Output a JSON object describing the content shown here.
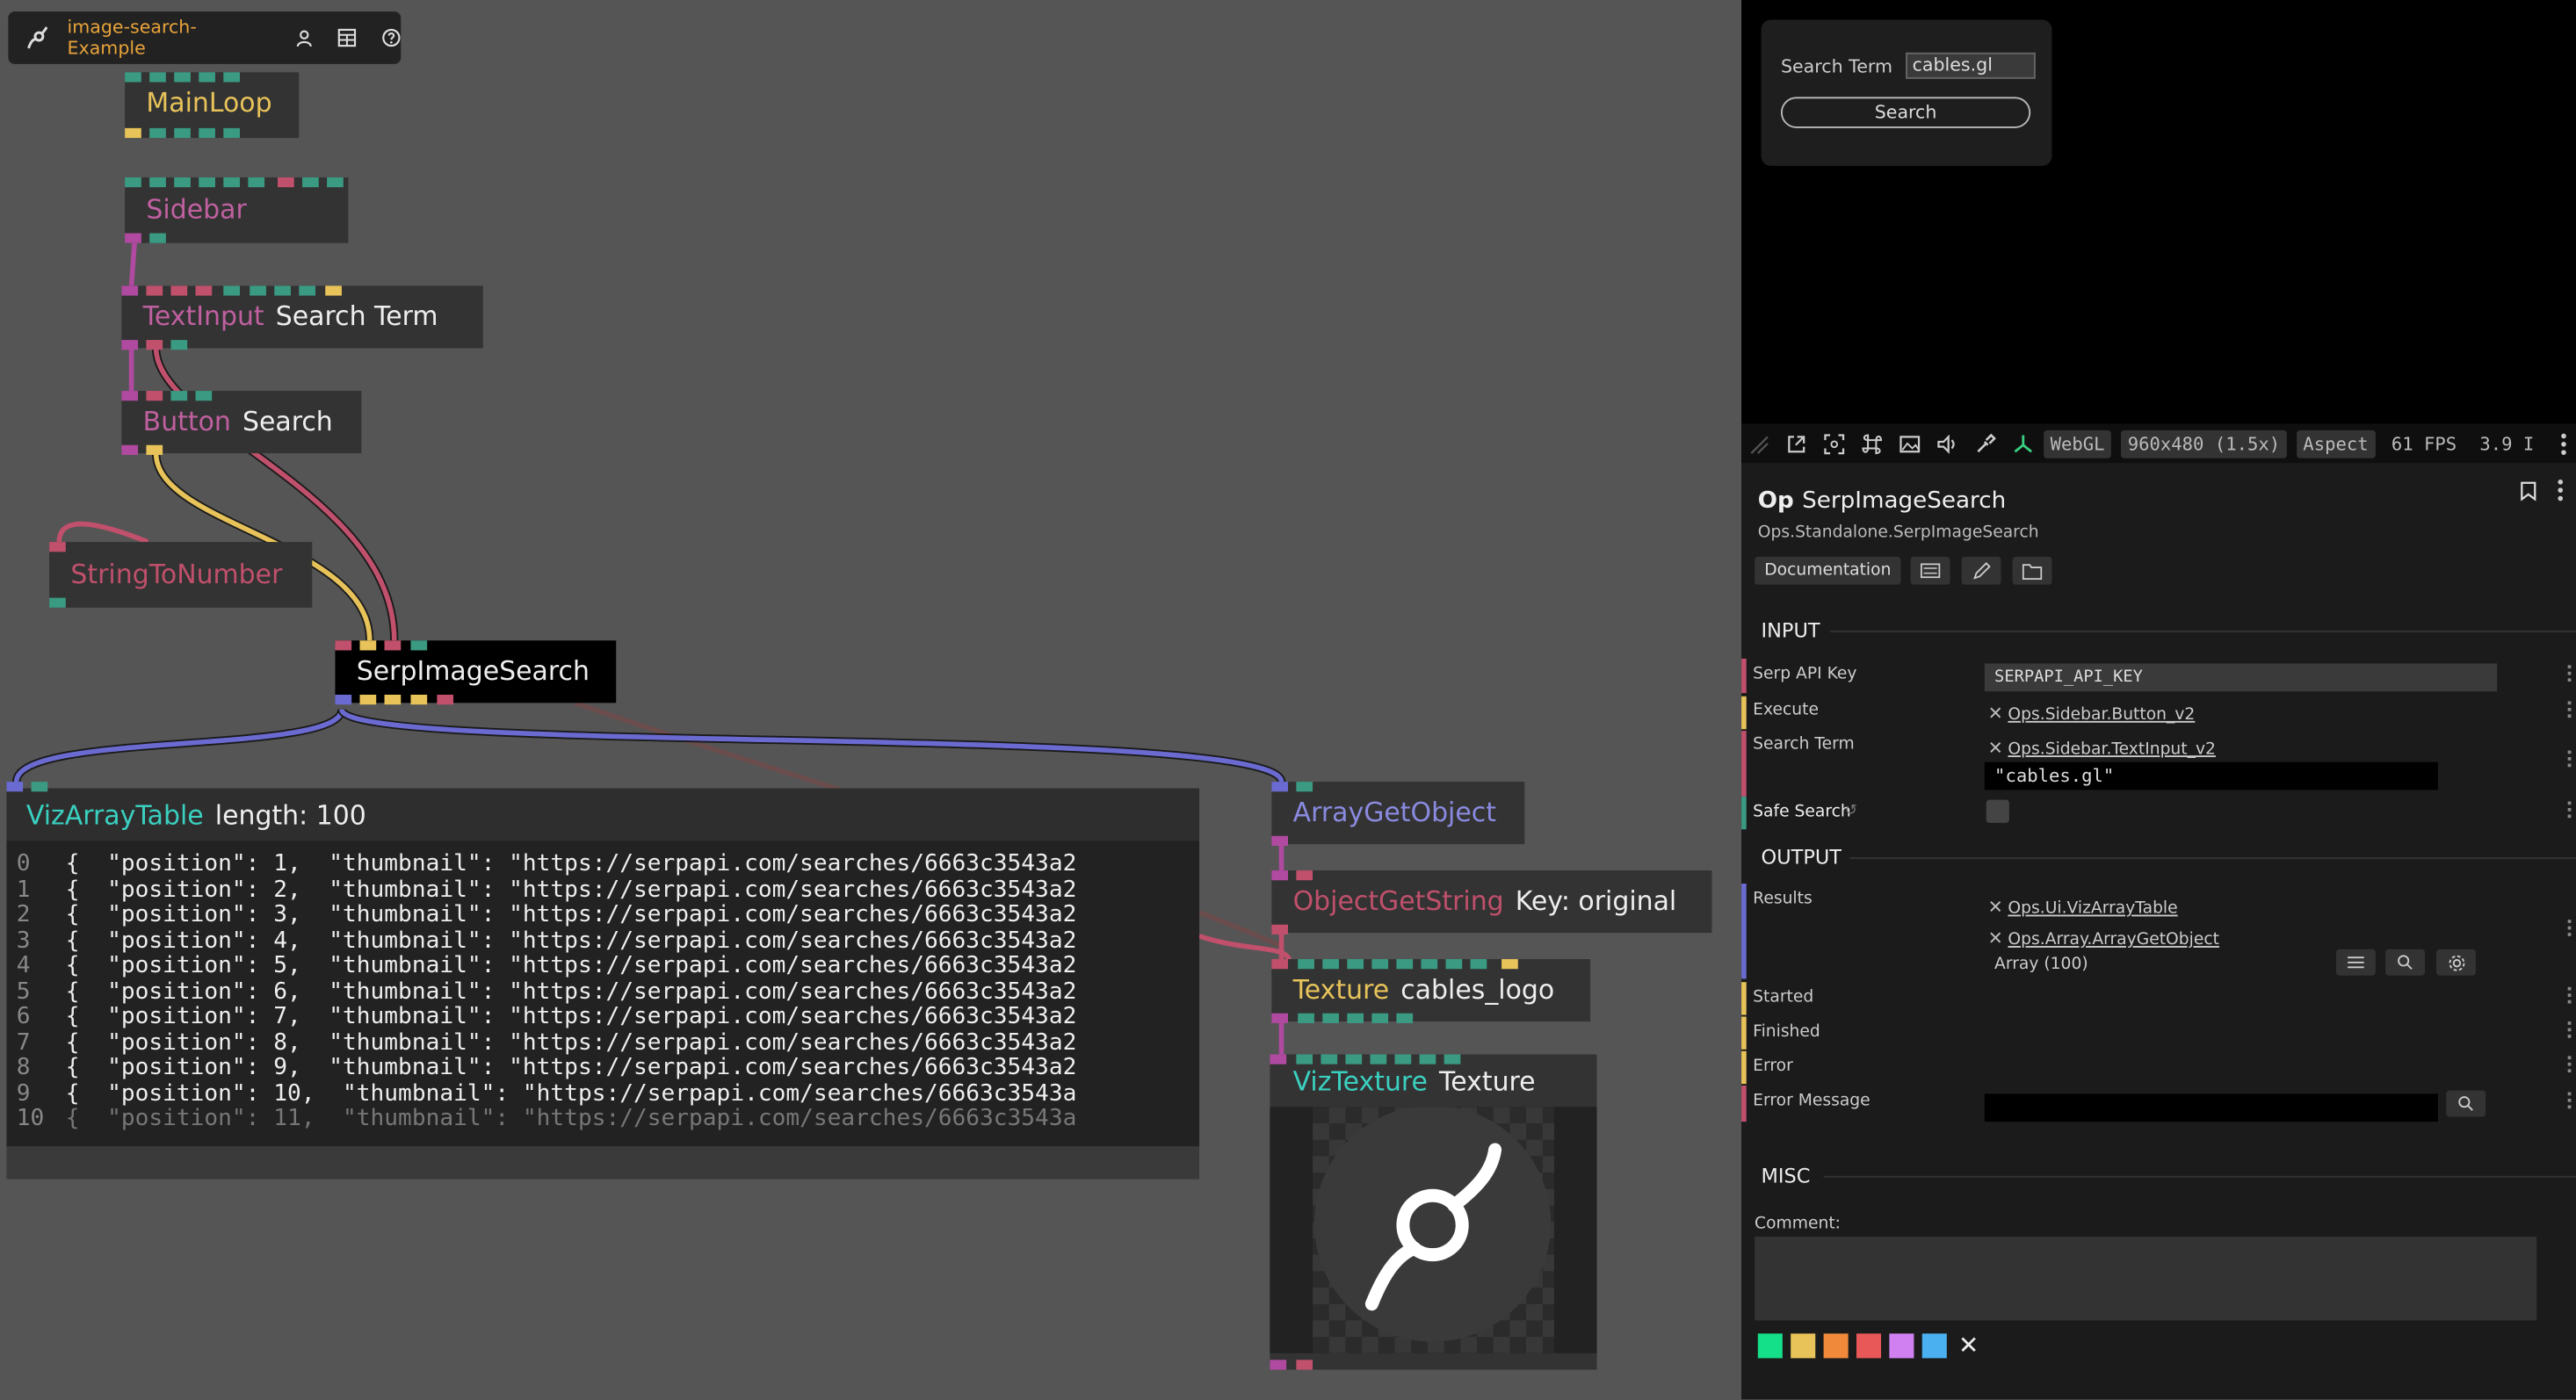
{
  "topbar": {
    "title": "image-search-Example"
  },
  "ops": {
    "mainloop": {
      "name": "MainLoop",
      "color": "#e8c35a"
    },
    "sidebar": {
      "name": "Sidebar",
      "color": "#c060a0"
    },
    "textinput": {
      "name": "TextInput",
      "title": "Search Term"
    },
    "button": {
      "name": "Button",
      "title": "Search"
    },
    "stringtonumber": {
      "name": "StringToNumber"
    },
    "serp": {
      "name": "SerpImageSearch"
    },
    "arraygetobject": {
      "name": "ArrayGetObject"
    },
    "objectgetstring": {
      "name": "ObjectGetString",
      "title": "Key: original"
    },
    "texture": {
      "name": "Texture",
      "title": "cables_logo"
    },
    "viztexture": {
      "name": "VizTexture",
      "title": "Texture"
    },
    "vizarraytable": {
      "name": "VizArrayTable",
      "title": "length: 100"
    }
  },
  "table_rows": [
    {
      "idx": "0",
      "text": "{  \"position\": 1,  \"thumbnail\": \"https://serpapi.com/searches/6663c3543a2"
    },
    {
      "idx": "1",
      "text": "{  \"position\": 2,  \"thumbnail\": \"https://serpapi.com/searches/6663c3543a2"
    },
    {
      "idx": "2",
      "text": "{  \"position\": 3,  \"thumbnail\": \"https://serpapi.com/searches/6663c3543a2"
    },
    {
      "idx": "3",
      "text": "{  \"position\": 4,  \"thumbnail\": \"https://serpapi.com/searches/6663c3543a2"
    },
    {
      "idx": "4",
      "text": "{  \"position\": 5,  \"thumbnail\": \"https://serpapi.com/searches/6663c3543a2"
    },
    {
      "idx": "5",
      "text": "{  \"position\": 6,  \"thumbnail\": \"https://serpapi.com/searches/6663c3543a2"
    },
    {
      "idx": "6",
      "text": "{  \"position\": 7,  \"thumbnail\": \"https://serpapi.com/searches/6663c3543a2"
    },
    {
      "idx": "7",
      "text": "{  \"position\": 8,  \"thumbnail\": \"https://serpapi.com/searches/6663c3543a2"
    },
    {
      "idx": "8",
      "text": "{  \"position\": 9,  \"thumbnail\": \"https://serpapi.com/searches/6663c3543a2"
    },
    {
      "idx": "9",
      "text": "{  \"position\": 10,  \"thumbnail\": \"https://serpapi.com/searches/6663c3543a"
    },
    {
      "idx": "10",
      "text": "{  \"position\": 11,  \"thumbnail\": \"https://serpapi.com/searches/6663c3543a"
    }
  ],
  "canvas_ui": {
    "search_term_label": "Search Term",
    "search_term_value": "cables.gl",
    "search_button": "Search"
  },
  "toolbar": {
    "renderer": "WebGL",
    "resolution": "960x480 (1.5x)",
    "aspect": "Aspect",
    "fps": "61 FPS",
    "version": "3.9 I"
  },
  "panel": {
    "op_label": "Op",
    "op_name": "SerpImageSearch",
    "op_path": "Ops.Standalone.SerpImageSearch",
    "doc_button": "Documentation",
    "input_header": "INPUT",
    "output_header": "OUTPUT",
    "misc_header": "MISC",
    "comment_label": "Comment:",
    "inputs": {
      "api_key_label": "Serp API Key",
      "api_key_value": "SERPAPI_API_KEY",
      "execute_label": "Execute",
      "execute_link": "Ops.Sidebar.Button_v2",
      "search_term_label": "Search Term",
      "search_term_link": "Ops.Sidebar.TextInput_v2",
      "search_term_value": "\"cables.gl\"",
      "safe_search_label": "Safe Search"
    },
    "outputs": {
      "results_label": "Results",
      "results_link1": "Ops.Ui.VizArrayTable",
      "results_link2": "Ops.Array.ArrayGetObject",
      "results_value": "Array (100)",
      "started_label": "Started",
      "finished_label": "Finished",
      "error_label": "Error",
      "error_message_label": "Error Message"
    }
  },
  "colors": {
    "string_port": "#c0506c",
    "trigger_port": "#e8c35a",
    "value_port": "#3a9a82",
    "object_port": "#6a6ad0",
    "texture_port": "#b04aa0",
    "swatches": [
      "#15e08a",
      "#e8c35a",
      "#f08a3a",
      "#e85858",
      "#d080f0",
      "#4ab0f0"
    ]
  }
}
